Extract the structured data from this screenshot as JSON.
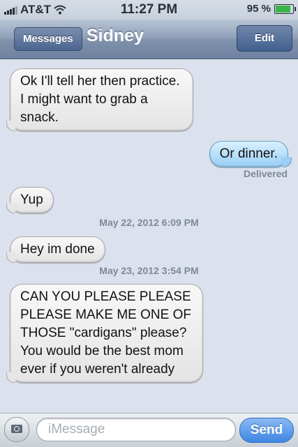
{
  "status_bar": {
    "carrier": "AT&T",
    "time": "11:27 PM",
    "battery_percent_text": "95 %",
    "battery_level": 0.95,
    "signal_bars": 4
  },
  "nav": {
    "back_label": "Messages",
    "contact_name": "Sidney",
    "edit_label": "Edit"
  },
  "messages": [
    {
      "direction": "incoming",
      "text": "Ok I'll tell her then practice. I might want to grab a snack."
    },
    {
      "direction": "outgoing",
      "text": "Or dinner.",
      "status": "Delivered"
    },
    {
      "direction": "incoming",
      "text": "Yup"
    },
    {
      "type": "timestamp",
      "text": "May 22, 2012 6:09 PM"
    },
    {
      "direction": "incoming",
      "text": "Hey im done"
    },
    {
      "type": "timestamp",
      "text": "May 23, 2012 3:54 PM"
    },
    {
      "direction": "incoming",
      "text": "CAN YOU PLEASE PLEASE PLEASE MAKE ME ONE OF THOSE \"cardigans\" please? You would be the best mom ever if you weren't already"
    }
  ],
  "composer": {
    "placeholder": "iMessage",
    "send_label": "Send",
    "camera_icon": "camera-icon"
  },
  "colors": {
    "background": "#dbe2ed",
    "outgoing_bubble": "#98cff5",
    "incoming_bubble": "#e4e4e4",
    "send_button": "#3e86e3",
    "battery_fill": "#39b54a"
  }
}
